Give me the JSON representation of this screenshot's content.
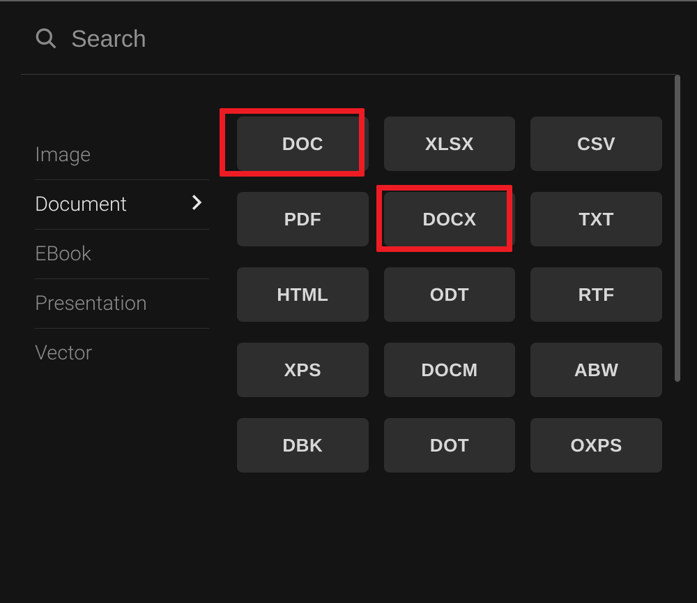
{
  "search": {
    "placeholder": "Search"
  },
  "sidebar": {
    "items": [
      {
        "label": "Image",
        "active": false
      },
      {
        "label": "Document",
        "active": true
      },
      {
        "label": "EBook",
        "active": false
      },
      {
        "label": "Presentation",
        "active": false
      },
      {
        "label": "Vector",
        "active": false
      }
    ]
  },
  "formats": [
    {
      "label": "DOC",
      "highlighted": true
    },
    {
      "label": "XLSX",
      "highlighted": false
    },
    {
      "label": "CSV",
      "highlighted": false
    },
    {
      "label": "PDF",
      "highlighted": false
    },
    {
      "label": "DOCX",
      "highlighted": true
    },
    {
      "label": "TXT",
      "highlighted": false
    },
    {
      "label": "HTML",
      "highlighted": false
    },
    {
      "label": "ODT",
      "highlighted": false
    },
    {
      "label": "RTF",
      "highlighted": false
    },
    {
      "label": "XPS",
      "highlighted": false
    },
    {
      "label": "DOCM",
      "highlighted": false
    },
    {
      "label": "ABW",
      "highlighted": false
    },
    {
      "label": "DBK",
      "highlighted": false
    },
    {
      "label": "DOT",
      "highlighted": false
    },
    {
      "label": "OXPS",
      "highlighted": false
    }
  ],
  "colors": {
    "highlight": "#ed1c24",
    "panel_bg": "#141414",
    "button_bg": "#2e2e2e"
  }
}
